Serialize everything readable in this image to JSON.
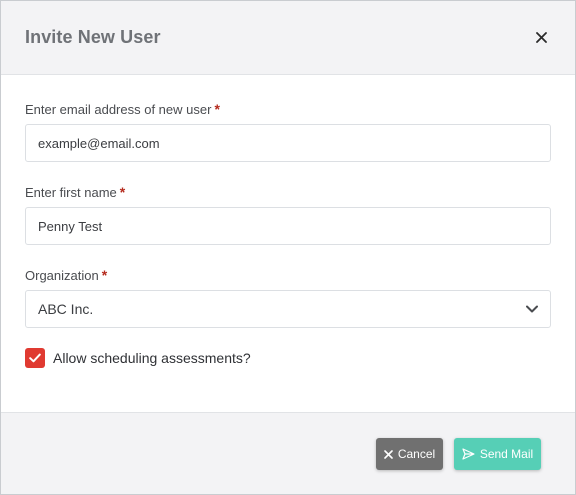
{
  "modal": {
    "title": "Invite New User"
  },
  "form": {
    "email": {
      "label": "Enter email address of new user",
      "required_mark": "*",
      "value": "example@email.com"
    },
    "first_name": {
      "label": "Enter first name",
      "required_mark": "*",
      "value": "Penny Test"
    },
    "organization": {
      "label": "Organization",
      "required_mark": "*",
      "selected": "ABC Inc."
    },
    "allow_scheduling": {
      "label": "Allow scheduling assessments?",
      "checked": true
    }
  },
  "footer": {
    "cancel_label": "Cancel",
    "send_label": "Send Mail"
  },
  "icons": {
    "close": "close-icon",
    "chevron": "chevron-down-icon",
    "check": "check-icon",
    "cancel": "x-icon",
    "send": "paper-plane-icon"
  },
  "colors": {
    "required": "#b52b1e",
    "checkbox": "#e03a31",
    "cancel_button": "#707070",
    "send_button": "#56cfb6",
    "header_bg": "#f3f3f5"
  }
}
